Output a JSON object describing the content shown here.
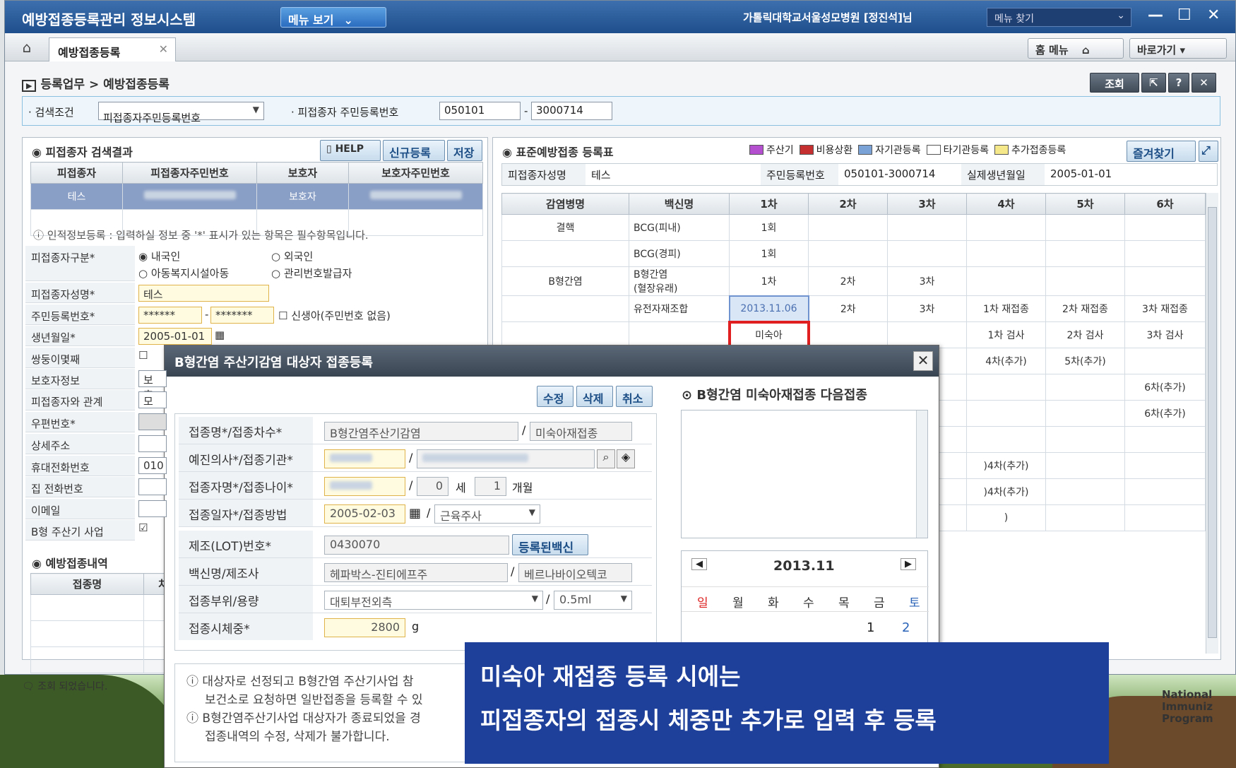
{
  "app": {
    "title": "예방접종등록관리 정보시스템",
    "menu_button": "메뉴 보기",
    "user": "가톨릭대학교서울성모병원 [정진석]님",
    "menu_search": "메뉴 찾기"
  },
  "tabs": {
    "home": "⌂",
    "active": "예방접종등록",
    "close": "✕",
    "home_menu": "홈 메뉴",
    "goto": "바로가기"
  },
  "breadcrumb": "등록업무 > 예방접종등록",
  "top_buttons": {
    "query": "조회",
    "help": "?",
    "close": "✕"
  },
  "search": {
    "cond_label": "· 검색조건",
    "cond_value": "피접종자주민등록번호",
    "id_label": "· 피접종자 주민등록번호",
    "id1": "050101",
    "id2": "3000714"
  },
  "left": {
    "title": "피접종자 검색결과",
    "help": "HELP",
    "new": "신규등록",
    "save": "저장",
    "cols": [
      "피접종자",
      "피접종자주민번호",
      "보호자",
      "보호자주민번호"
    ],
    "row": {
      "name": "테스",
      "guardian": "보호자"
    },
    "notice": "인적정보등록 : 입력하실 정보 중 '*' 표시가 있는 항목은 필수항목입니다.",
    "fields": [
      "피접종자구분*",
      "피접종자성명*",
      "주민등록번호*",
      "생년월일*",
      "쌍둥이몇째",
      "보호자정보",
      "피접종자와 관계",
      "우편번호*",
      "상세주소",
      "휴대전화번호",
      "집 전화번호",
      "이메일",
      "B형 주산기 사업"
    ],
    "type_options": [
      "내국인",
      "외국인",
      "아동복지시설아동",
      "관리번호발급자"
    ],
    "name_val": "테스",
    "rrn1": "******",
    "rrn2": "*******",
    "newborn": "신생아(주민번호 없음)",
    "birth": "2005-01-01",
    "guardian_val": "보호",
    "relation_val": "모",
    "phone_val": "010",
    "history_title": "예방접종내역",
    "history_cols": [
      "접종명",
      "차수"
    ],
    "status": "조회 되었습니다."
  },
  "right": {
    "title": "표준예방접종 등록표",
    "legend": [
      "주산기",
      "비용상환",
      "자기관등록",
      "타기관등록",
      "추가접종등록"
    ],
    "legend_colors": [
      "#b44fd0",
      "#c62f2f",
      "#7aa2d6",
      "#ffffff",
      "#f5e88a"
    ],
    "fav": "즐겨찾기",
    "info": {
      "name_label": "피접종자성명",
      "name": "테스",
      "rrn_label": "주민등록번호",
      "rrn": "050101-3000714",
      "birth_label": "실제생년월일",
      "birth": "2005-01-01"
    },
    "cols": [
      "감염병명",
      "백신명",
      "1차",
      "2차",
      "3차",
      "4차",
      "5차",
      "6차"
    ],
    "rows": [
      {
        "disease": "결핵",
        "vaccine": "BCG(피내)",
        "c": [
          "1회",
          "",
          "",
          "",
          "",
          ""
        ]
      },
      {
        "disease": "",
        "vaccine": "BCG(경피)",
        "c": [
          "1회",
          "",
          "",
          "",
          "",
          ""
        ]
      },
      {
        "disease": "B형간염",
        "vaccine": "B형간염\n(혈장유래)",
        "c": [
          "1차",
          "2차",
          "3차",
          "",
          "",
          ""
        ]
      },
      {
        "disease": "",
        "vaccine": "유전자재조합",
        "c": [
          "2013.11.06",
          "2차",
          "3차",
          "1차 재접종",
          "2차 재접종",
          "3차 재접종"
        ]
      },
      {
        "disease": "",
        "vaccine": "",
        "c": [
          "미숙아",
          "",
          "",
          "1차 검사",
          "2차 검사",
          "3차 검사"
        ]
      },
      {
        "disease": "",
        "vaccine": "",
        "c": [
          "",
          "",
          "",
          "4차(추가)",
          "5차(추가)",
          ""
        ]
      },
      {
        "disease": "",
        "vaccine": "",
        "c": [
          "",
          "",
          "",
          "",
          "",
          "6차(추가)"
        ]
      },
      {
        "disease": "",
        "vaccine": "",
        "c": [
          "",
          "",
          "",
          "",
          "",
          "6차(추가)"
        ]
      },
      {
        "disease": "",
        "vaccine": "",
        "c": [
          "",
          "",
          "",
          "",
          "",
          ""
        ]
      },
      {
        "disease": "",
        "vaccine": "",
        "c": [
          "",
          "",
          "",
          ")4차(추가)",
          "",
          ""
        ]
      },
      {
        "disease": "",
        "vaccine": "",
        "c": [
          "",
          "",
          "",
          ")4차(추가)",
          "",
          ""
        ]
      },
      {
        "disease": "",
        "vaccine": "",
        "c": [
          "",
          "",
          "",
          ")",
          "",
          ""
        ]
      }
    ]
  },
  "dialog": {
    "title": "B형간염 주산기감염 대상자 접종등록",
    "edit": "수정",
    "delete": "삭제",
    "cancel": "취소",
    "f1_label": "접종명*/접종차수*",
    "f1_a": "B형간염주산기감염",
    "f1_b": "미숙아재접종",
    "f2_label": "예진의사*/접종기관*",
    "f3_label": "접종자명*/접종나이*",
    "age_y": "0",
    "age_y_unit": "세",
    "age_m": "1",
    "age_m_unit": "개월",
    "f4_label": "접종일자*/접종방법",
    "date": "2005-02-03",
    "method": "근육주사",
    "f5_label": "제조(LOT)번호*",
    "lot": "0430070",
    "reg_vaccine": "등록된백신",
    "f6_label": "백신명/제조사",
    "vaccine": "헤파박스-진티에프주",
    "maker": "베르나바이오텍코",
    "f7_label": "접종부위/용량",
    "site": "대퇴부전외측",
    "dose": "0.5ml",
    "f8_label": "접종시체중*",
    "weight": "2800",
    "weight_unit": "g",
    "next_title": "B형간염 미숙아재접종 다음접종",
    "cal_month": "2013.11",
    "days": [
      "일",
      "월",
      "화",
      "수",
      "목",
      "금",
      "토"
    ],
    "d1": "1",
    "d2": "2",
    "info1": "대상자로 선정되고 B형간염 주산기사업 참",
    "info1b": "보건소로 요청하면 일반접종을 등록할 수 있",
    "info2": "B형간염주산기사업 대상자가 종료되었을 경",
    "info2b": "접종내역의 수정, 삭제가 불가합니다."
  },
  "overlay": {
    "line1": "미숙아 재접종 등록 시에는",
    "line2": "피접종자의 접종시 체중만 추가로 입력 후 등록"
  },
  "bg_text": [
    "National",
    "Immuniz",
    "Program"
  ]
}
